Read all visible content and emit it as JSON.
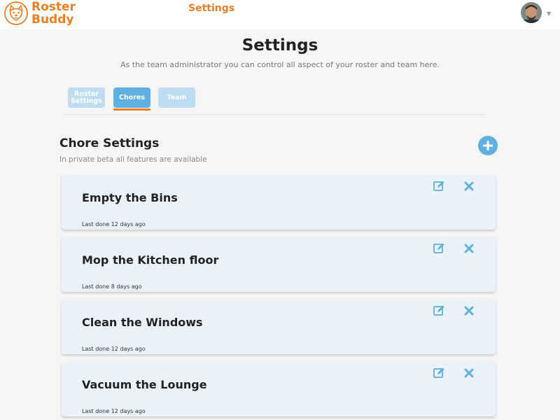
{
  "header": {
    "logo_line1": "Roster",
    "logo_line2": "Buddy",
    "nav_title": "Settings",
    "avatar_icon": "user-avatar",
    "menu_icon": "caret-down-icon"
  },
  "page": {
    "title": "Settings",
    "subtitle": "As the team administrator you can control all aspect of your roster and team here."
  },
  "tabs": [
    {
      "label": "Roster Settings",
      "active": false
    },
    {
      "label": "Chores",
      "active": true
    },
    {
      "label": "Team",
      "active": false
    }
  ],
  "section": {
    "title": "Chore Settings",
    "subtitle": "In private beta all features are available",
    "add_icon": "plus-icon"
  },
  "chores": [
    {
      "name": "Empty the Bins",
      "last_done": "Last done 12 days ago"
    },
    {
      "name": "Mop the Kitchen floor",
      "last_done": "Last done 8 days ago"
    },
    {
      "name": "Clean the Windows",
      "last_done": "Last done 12 days ago"
    },
    {
      "name": "Vacuum the Lounge",
      "last_done": "Last done 12 days ago"
    }
  ],
  "colors": {
    "brand": "#ef7d22",
    "accent": "#5fb0e0",
    "accent_light": "#bcdcf1",
    "card": "#e9f1f9"
  }
}
